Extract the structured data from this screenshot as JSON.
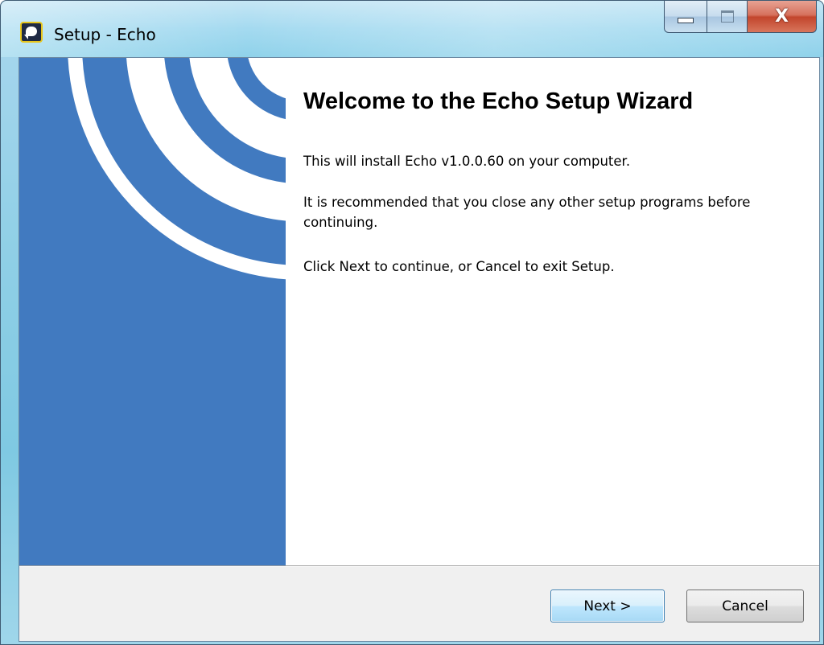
{
  "window": {
    "title": "Setup - Echo",
    "app_icon": "echo-app-icon",
    "caption_buttons": {
      "minimize_icon": "minimize-icon",
      "maximize_icon": "maximize-icon",
      "close_glyph": "X"
    }
  },
  "wizard": {
    "side_image": "concentric-arcs-graphic",
    "heading": "Welcome to the Echo Setup Wizard",
    "paragraphs": [
      "This will install Echo v1.0.0.60 on your computer.",
      "It is recommended that you close any other setup programs before continuing.",
      "Click Next to continue, or Cancel to exit Setup."
    ]
  },
  "buttons": {
    "next_label": "Next >",
    "cancel_label": "Cancel"
  },
  "colors": {
    "side_panel_blue": "#417ac0",
    "close_button_red": "#c2452c",
    "default_button_border": "#3c7fb1"
  }
}
